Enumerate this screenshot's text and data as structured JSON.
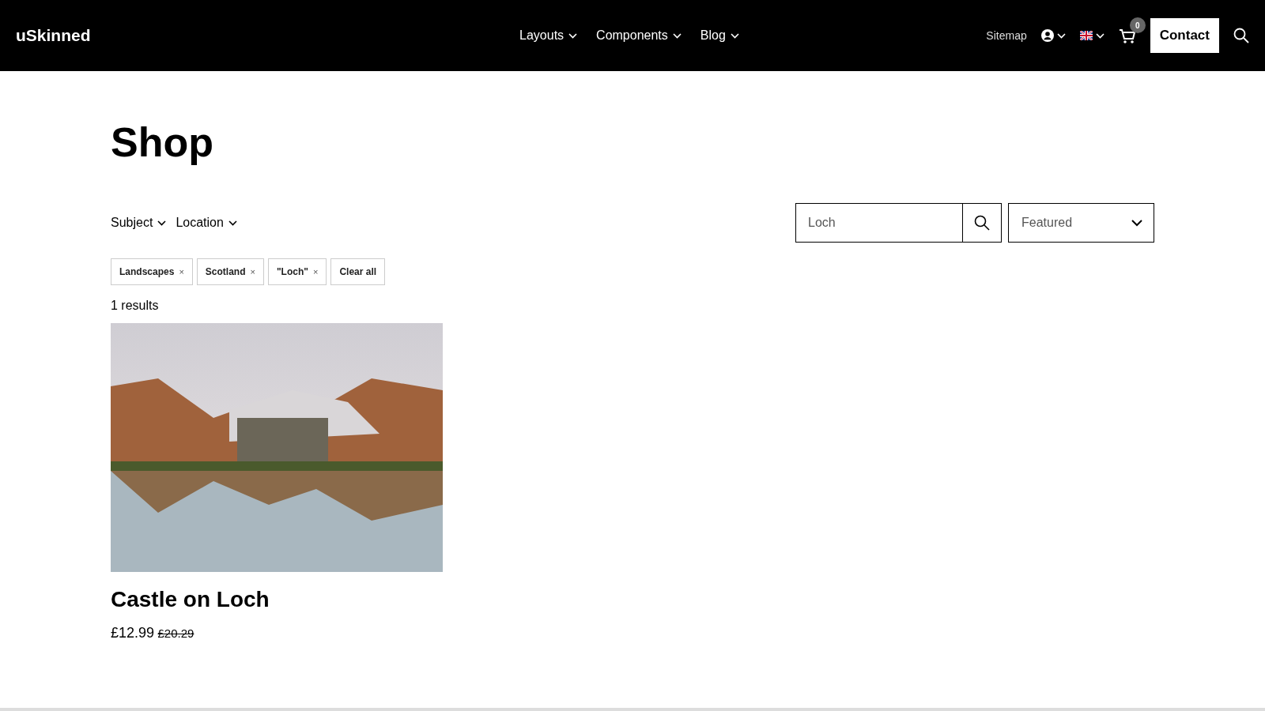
{
  "header": {
    "logo": "uSkinned",
    "nav": [
      {
        "label": "Layouts"
      },
      {
        "label": "Components"
      },
      {
        "label": "Blog"
      }
    ],
    "sitemap": "Sitemap",
    "cart_count": "0",
    "contact": "Contact"
  },
  "page": {
    "title": "Shop"
  },
  "filters": [
    {
      "label": "Subject"
    },
    {
      "label": "Location"
    }
  ],
  "search": {
    "value": "Loch"
  },
  "sort": {
    "value": "Featured"
  },
  "chips": [
    {
      "label": "Landscapes",
      "kind": "removable",
      "remove": "×"
    },
    {
      "label": "Scotland",
      "kind": "removable",
      "remove": "×"
    },
    {
      "label": "\"Loch\"",
      "kind": "removable",
      "remove": "×"
    },
    {
      "label": "Clear all",
      "kind": "clear"
    }
  ],
  "results_count": "1 results",
  "products": [
    {
      "title": "Castle on Loch",
      "price": "£12.99",
      "old_price": "£20.29"
    }
  ]
}
